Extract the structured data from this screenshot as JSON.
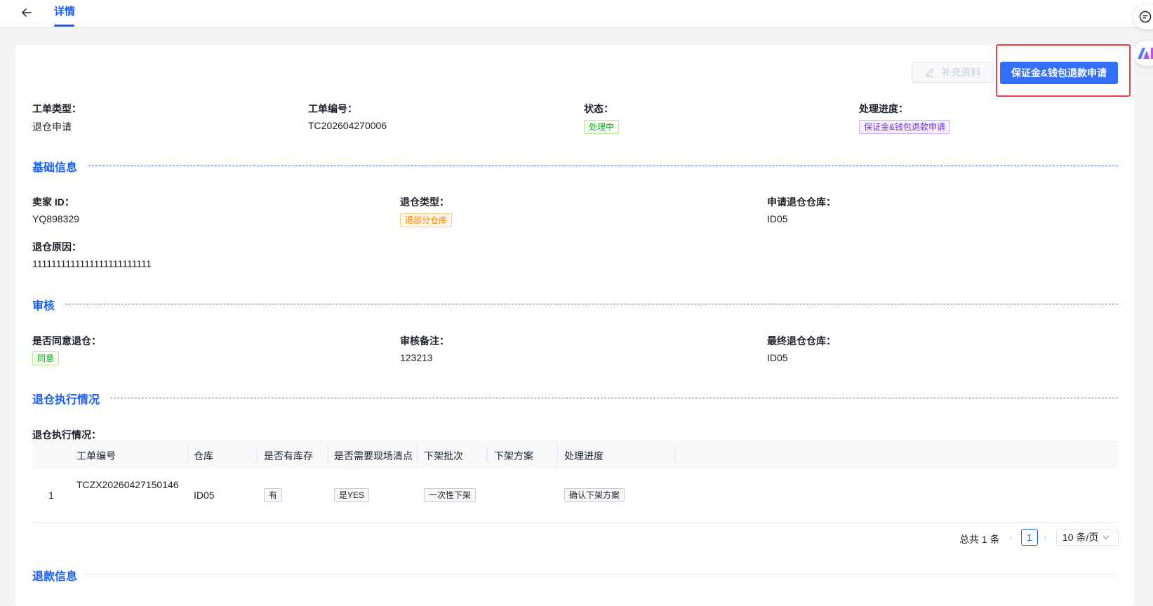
{
  "header": {
    "tab": "详情"
  },
  "actions": {
    "supplement_label": "补充资料",
    "refund_label": "保证金&钱包退款申请"
  },
  "summary": {
    "type_label": "工单类型：",
    "type_value": "退仓申请",
    "no_label": "工单编号：",
    "no_value": "TC202604270006",
    "status_label": "状态：",
    "status_value": "处理中",
    "progress_label": "处理进度：",
    "progress_value": "保证金&钱包退款申请"
  },
  "basic": {
    "title": "基础信息",
    "seller_label": "卖家 ID：",
    "seller_value": "YQ898329",
    "return_type_label": "退仓类型：",
    "return_type_value": "退部分仓库",
    "apply_wh_label": "申请退仓仓库：",
    "apply_wh_value": "ID05",
    "reason_label": "退仓原因：",
    "reason_value": "1111111111111111111111111"
  },
  "review": {
    "title": "审核",
    "agree_label": "是否同意退仓：",
    "agree_value": "同意",
    "remark_label": "审核备注：",
    "remark_value": "123213",
    "final_wh_label": "最终退仓仓库：",
    "final_wh_value": "ID05"
  },
  "execution": {
    "title": "退仓执行情况",
    "sub_label": "退仓执行情况：",
    "columns": [
      "工单编号",
      "仓库",
      "是否有库存",
      "是否需要现场清点",
      "下架批次",
      "下架方案",
      "处理进度"
    ],
    "rows": [
      {
        "index": "1",
        "order_no": "TCZX20260427150146",
        "warehouse": "ID05",
        "has_stock": "有",
        "need_count": "是YES",
        "batch": "一次性下架",
        "plan": "",
        "progress": "确认下架方案"
      }
    ]
  },
  "pagination": {
    "total": "总共 1 条",
    "current": "1",
    "page_size": "10 条/页"
  },
  "refund": {
    "title": "退款信息"
  },
  "colors": {
    "primary": "#3370ff",
    "alert_frame": "#f53f3f",
    "status_green": "#00b42a",
    "progress_purple": "#722ed1",
    "orange": "#ff7d00"
  }
}
